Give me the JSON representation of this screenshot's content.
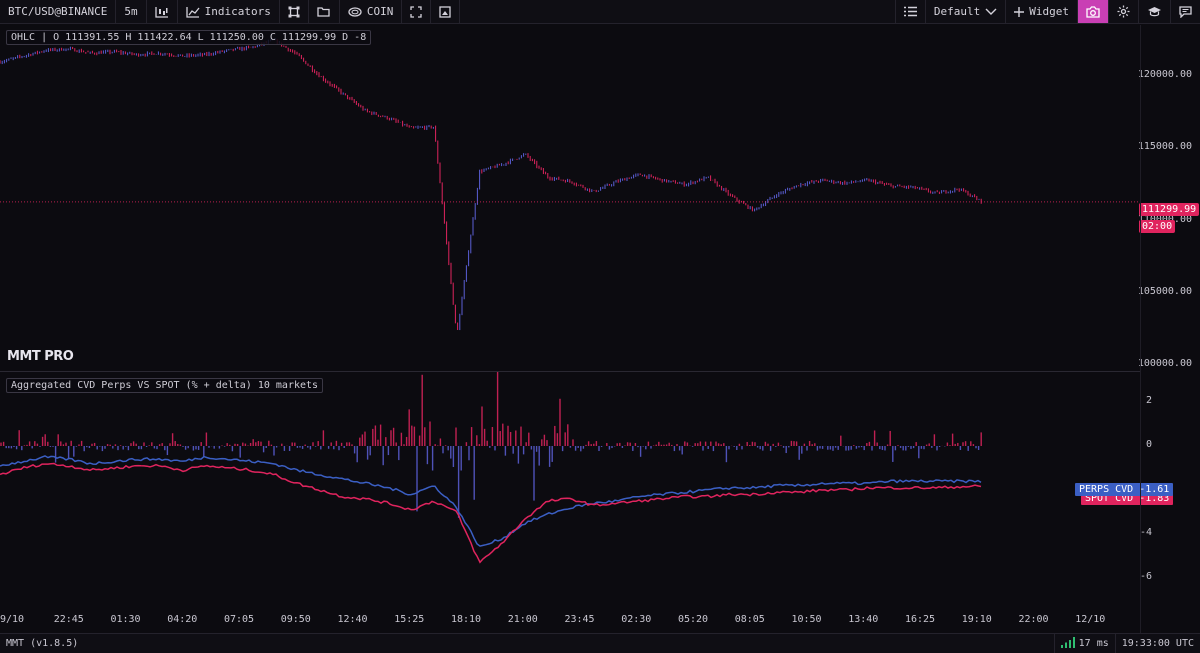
{
  "toolbar": {
    "symbol": "BTC/USD@BINANCE",
    "timeframe": "5m",
    "indicators_label": "Indicators",
    "coin_label": "COIN",
    "layout_label": "Default",
    "widget_label": "Widget"
  },
  "price_pane": {
    "ohlc": "OHLC | O 111391.55 H 111422.64 L 111250.00 C 111299.99 D -8",
    "y_axis_labels": [
      "120000.00",
      "115000.00",
      "110000.00",
      "105000.00",
      "100000.00"
    ],
    "last_price": "111299.99",
    "countdown": "02:00"
  },
  "brand": "MMT PRO",
  "cvd_pane": {
    "legend": "Aggregated CVD Perps VS SPOT (% + delta) 10 markets",
    "y_axis_labels": [
      "2",
      "0",
      "-2",
      "-4",
      "-6"
    ],
    "perps_label": "PERPS CVD",
    "perps_value": "-1.61",
    "spot_label": "SPOT CVD",
    "spot_value": "-1.83"
  },
  "time_axis": [
    "9/10",
    "22:45",
    "01:30",
    "04:20",
    "07:05",
    "09:50",
    "12:40",
    "15:25",
    "18:10",
    "21:00",
    "23:45",
    "02:30",
    "05:20",
    "08:05",
    "10:50",
    "13:40",
    "16:25",
    "19:10",
    "22:00",
    "12/10"
  ],
  "status": {
    "version": "MMT (v1.8.5)",
    "latency": "17 ms",
    "clock": "19:33:00 UTC"
  },
  "colors": {
    "up": "#5b5fd6",
    "down": "#e0245e",
    "accent": "#c93fb4",
    "perps": "#3b5fc4",
    "spot": "#e0245e"
  },
  "chart_data": [
    {
      "type": "line",
      "title": "",
      "ylim": [
        100000,
        123000
      ],
      "series": [
        {
          "values": [
            121000,
            121400,
            121800,
            121900,
            121600,
            121700,
            121500,
            121600,
            121400,
            121500,
            121800,
            122000,
            122500,
            121500,
            120000,
            118800,
            117600,
            117100,
            116400,
            116500,
            102000,
            113400,
            113900,
            114600,
            113000,
            112700,
            112000,
            112700,
            113200,
            112800,
            112500,
            113000,
            111700,
            110700,
            111800,
            112500,
            112800,
            112600,
            112800,
            112400,
            112300,
            111900,
            112200,
            111300
          ]
        }
      ]
    },
    {
      "type": "line",
      "title": "",
      "ylim": [
        -7,
        3
      ],
      "series": [
        {
          "name": "PERPS CVD",
          "values": [
            -0.9,
            -0.7,
            -0.5,
            -0.6,
            -0.8,
            -0.7,
            -0.6,
            -0.6,
            -0.7,
            -0.5,
            -0.6,
            -0.7,
            -0.8,
            -1.1,
            -1.3,
            -1.5,
            -1.7,
            -1.9,
            -2.2,
            -1.8,
            -2.8,
            -4.6,
            -4.2,
            -3.5,
            -3.1,
            -2.8,
            -2.6,
            -2.5,
            -2.3,
            -2.2,
            -2.1,
            -2.0,
            -1.9,
            -1.9,
            -1.8,
            -1.8,
            -1.7,
            -1.7,
            -1.7,
            -1.6,
            -1.6,
            -1.6,
            -1.6,
            -1.61
          ]
        },
        {
          "name": "SPOT CVD",
          "values": [
            -1.3,
            -1.0,
            -0.8,
            -0.9,
            -1.1,
            -1.0,
            -0.9,
            -0.9,
            -1.1,
            -0.9,
            -1.0,
            -1.1,
            -1.3,
            -1.7,
            -2.0,
            -2.3,
            -2.4,
            -2.6,
            -2.9,
            -2.5,
            -3.0,
            -5.3,
            -4.4,
            -3.3,
            -2.5,
            -2.4,
            -2.7,
            -2.6,
            -2.5,
            -2.4,
            -2.3,
            -2.3,
            -2.2,
            -2.2,
            -2.1,
            -2.1,
            -2.0,
            -2.0,
            -1.9,
            -1.9,
            -1.9,
            -1.9,
            -1.85,
            -1.83
          ]
        }
      ]
    }
  ]
}
